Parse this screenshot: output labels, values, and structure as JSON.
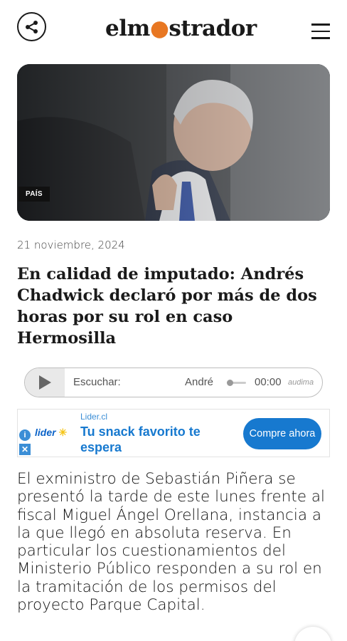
{
  "header": {
    "logo_prefix": "elm",
    "logo_suffix": "strador",
    "share_icon": "share-icon",
    "menu_icon": "hamburger-menu-icon"
  },
  "hero": {
    "section_tag": "PAÍS"
  },
  "article": {
    "date": "21 noviembre, 2024",
    "headline": "En calidad de imputado: Andrés Chadwick declaró por más de dos horas por su rol en caso Hermosilla",
    "body": "El exministro de Sebastián Piñera se presentó la tarde de este lunes frente al fiscal Miguel Ángel Orellana, instancia a la que llegó en absoluta reserva. En particular los cuestionamientos del Ministerio Público responden a su rol en la tramitación de los permisos del proyecto Parque Capital."
  },
  "player": {
    "listen_label": "Escuchar:",
    "track_title": "Andrés Chadwick",
    "time": "00:00",
    "brand": "audima"
  },
  "ad": {
    "source": "Lider.cl",
    "logo_text": "lider",
    "title": "Tu snack favorito te espera",
    "cta": "Compre ahora",
    "info_icon": "i",
    "close_icon": "✕"
  },
  "colors": {
    "accent": "#e87722",
    "ad_blue": "#1779cf"
  }
}
